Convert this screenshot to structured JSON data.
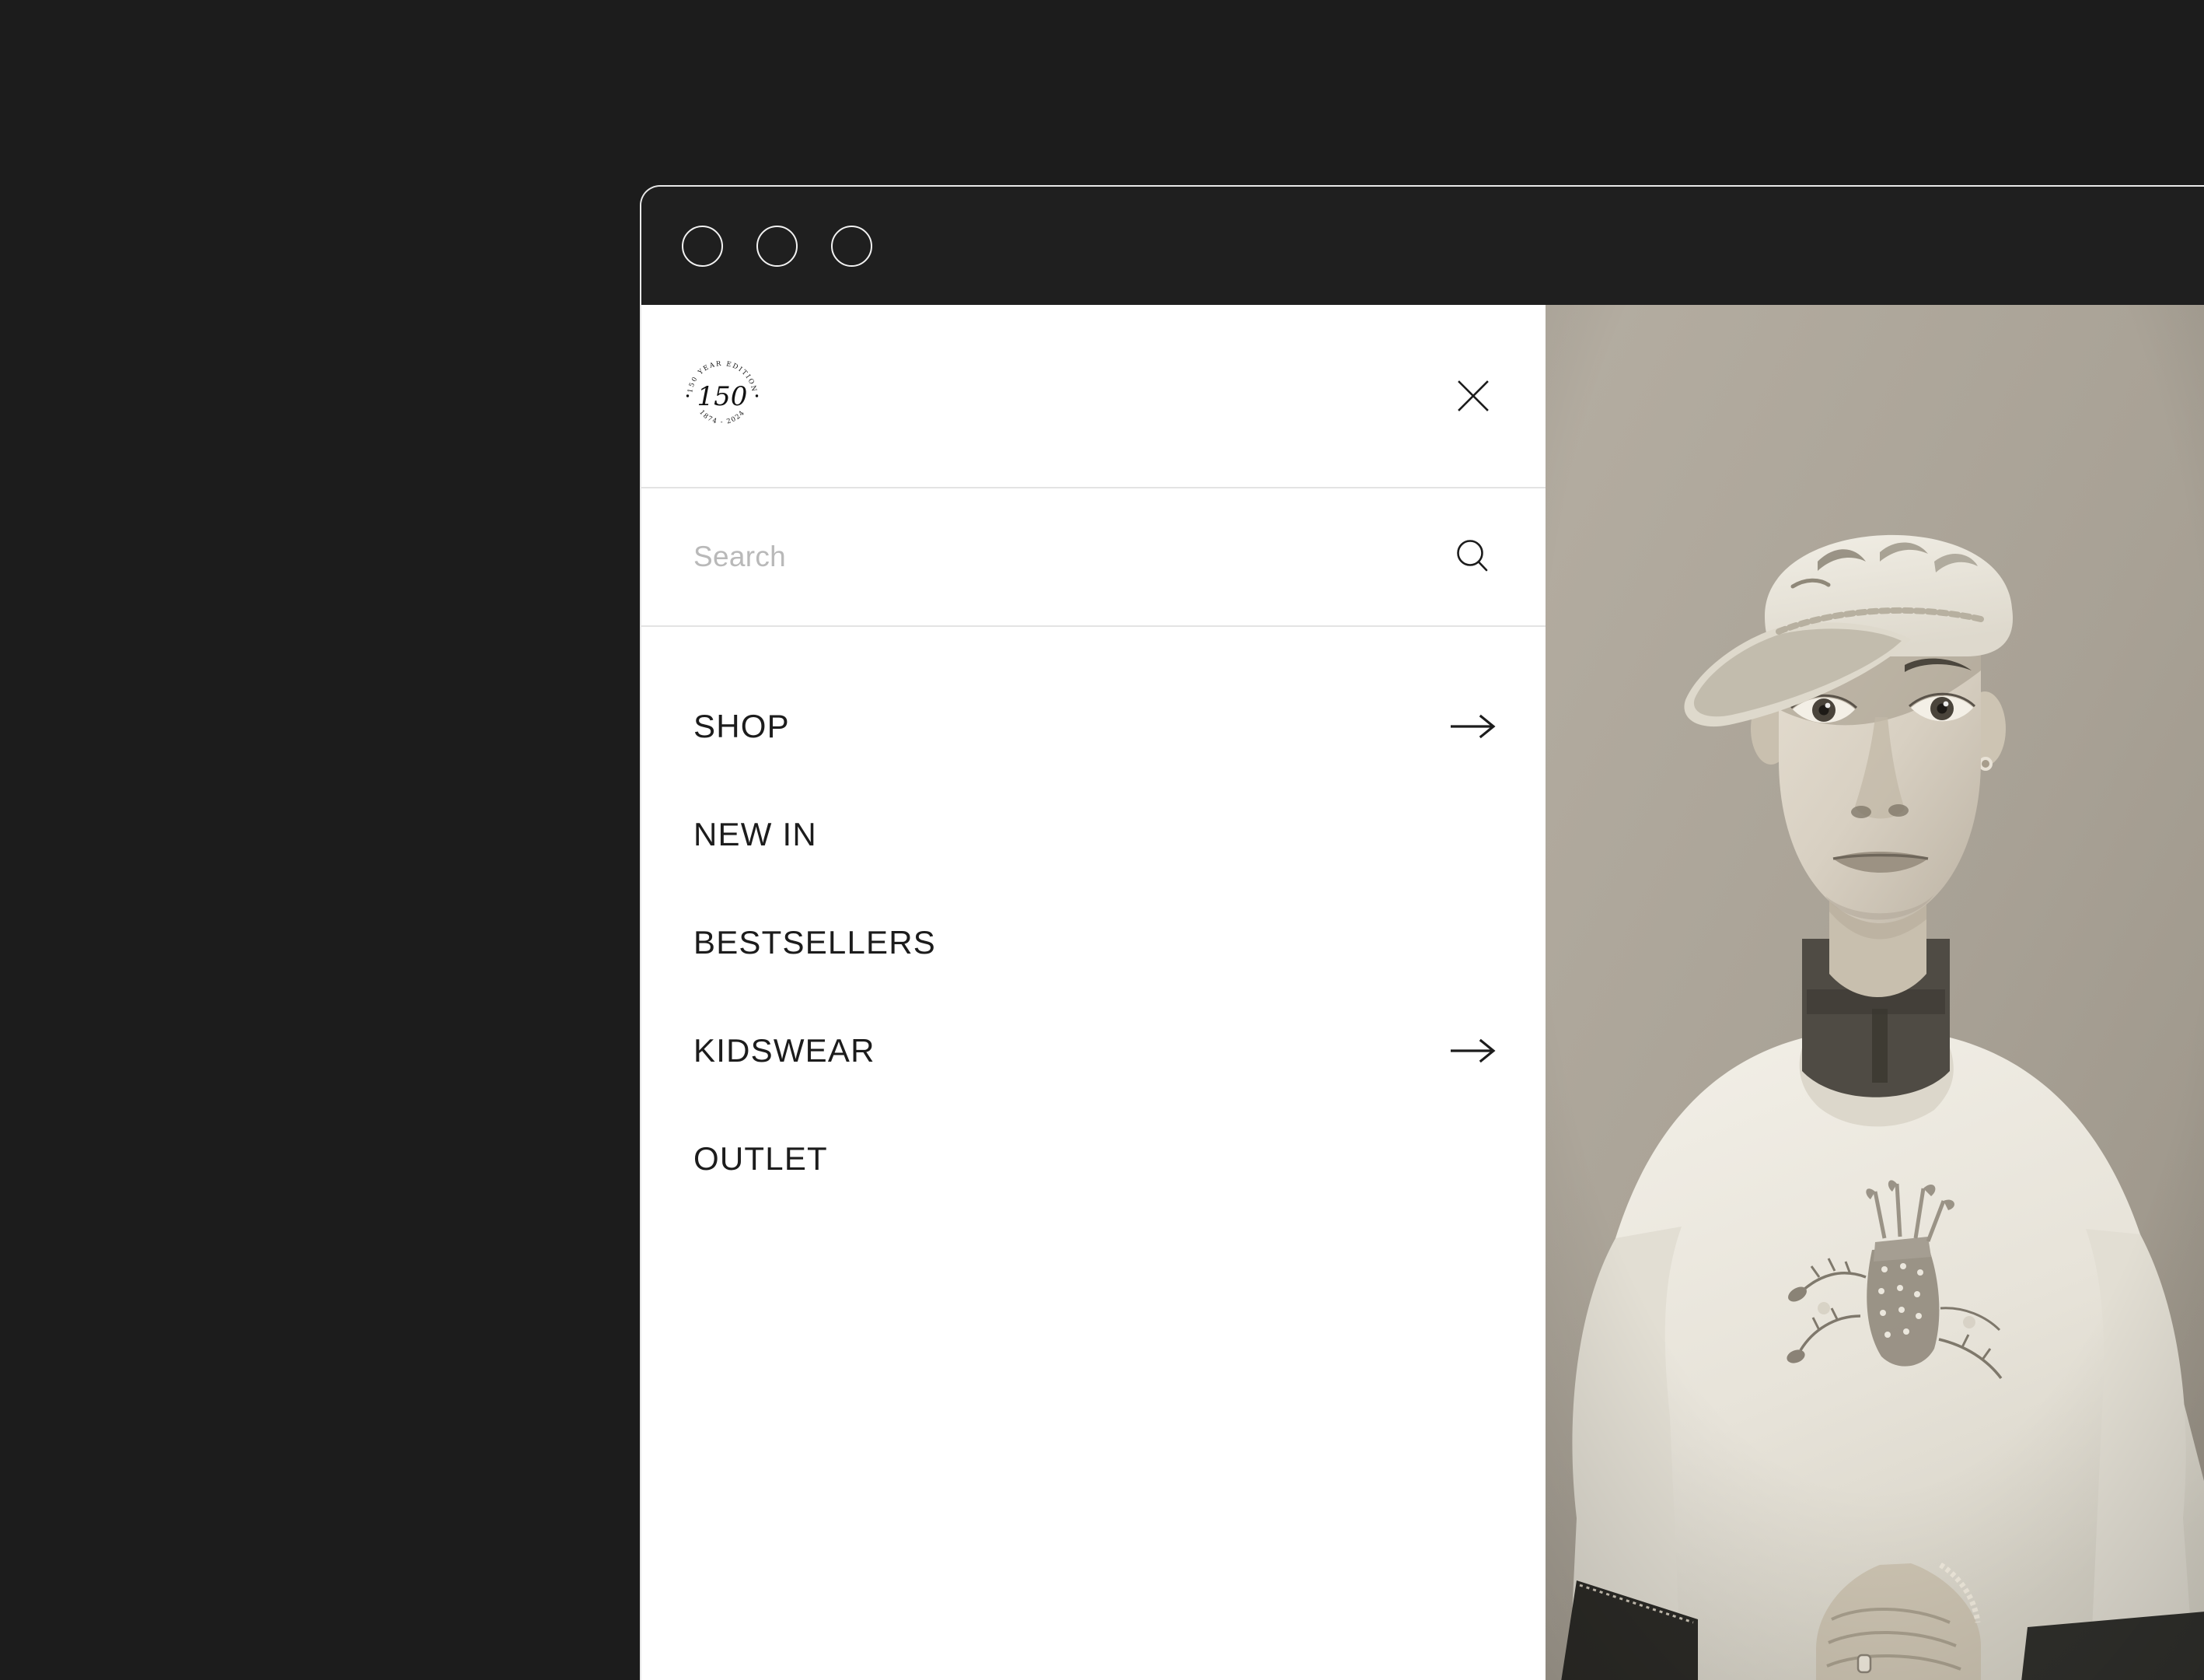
{
  "page": {
    "background_color": "#1c1c1c"
  },
  "browser": {
    "chrome_color": "#1f1f1f",
    "window_controls": [
      {
        "name": "close",
        "label": ""
      },
      {
        "name": "minimize",
        "label": ""
      },
      {
        "name": "maximize",
        "label": ""
      }
    ]
  },
  "menu_panel": {
    "background_color": "#ffffff",
    "logo": {
      "icon": "anniversary-badge-icon",
      "top_arc_text": "150 YEAR EDITION",
      "center_text": "150",
      "bottom_arc_text": "1874 - 2024"
    },
    "close_button": {
      "icon": "close-icon",
      "label": "Close"
    },
    "search": {
      "placeholder": "Search",
      "value": "",
      "submit_icon": "search-icon",
      "placeholder_color": "#b9b9b9"
    },
    "nav_items": [
      {
        "label": "SHOP",
        "has_arrow": true,
        "icon": "arrow-right-icon"
      },
      {
        "label": "NEW IN",
        "has_arrow": false,
        "icon": ""
      },
      {
        "label": "BESTSELLERS",
        "has_arrow": false,
        "icon": ""
      },
      {
        "label": "KIDSWEAR",
        "has_arrow": true,
        "icon": "arrow-right-icon"
      },
      {
        "label": "OUTLET",
        "has_arrow": false,
        "icon": ""
      }
    ]
  },
  "hero": {
    "image_description": "Sepia portrait of a young man in a cream flat cap and white crewneck sweatshirt with embroidered golf bag",
    "tone_color": "#a9a397",
    "alt": "150 Year Edition campaign portrait"
  }
}
